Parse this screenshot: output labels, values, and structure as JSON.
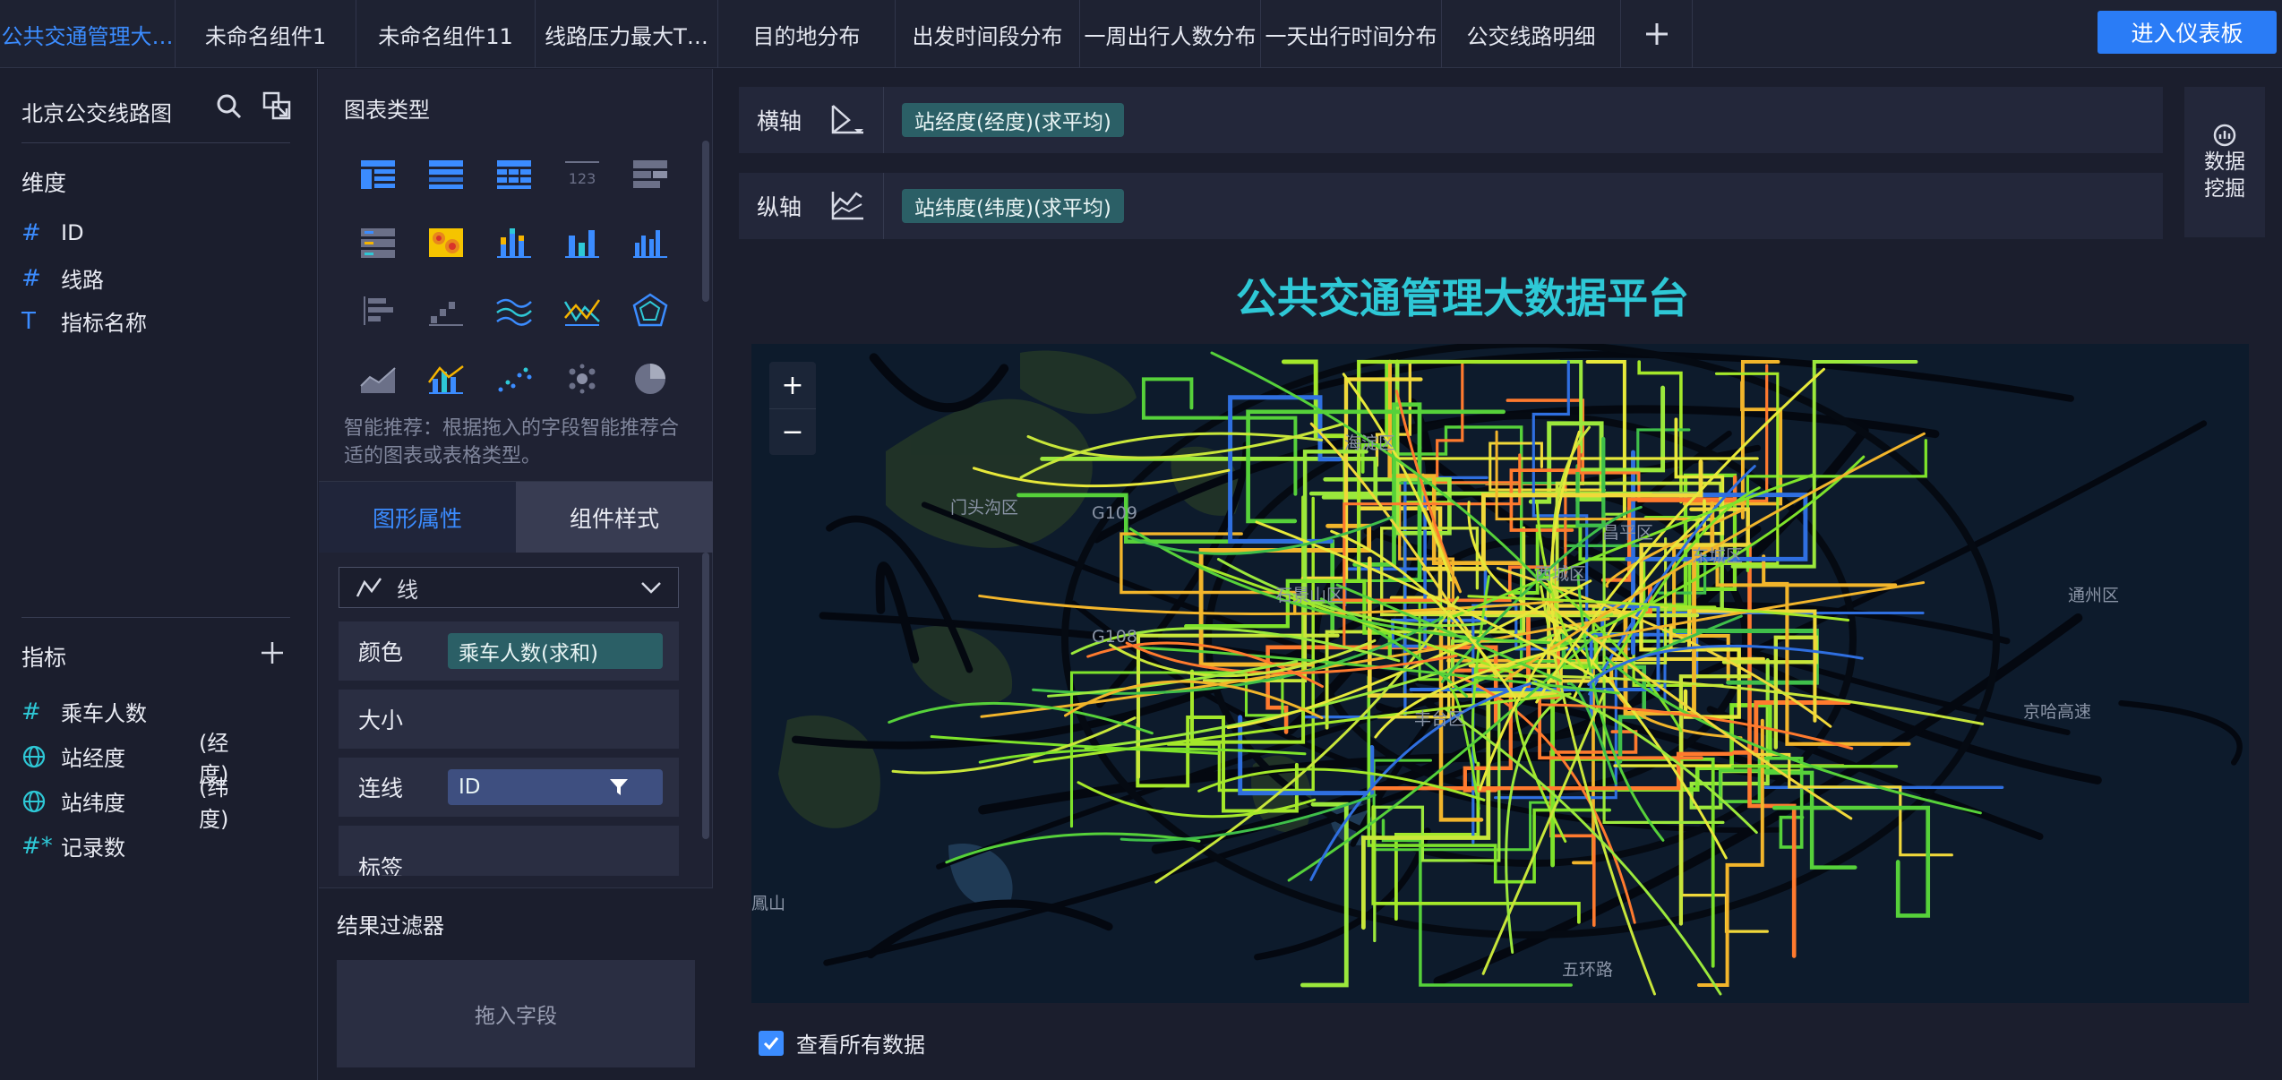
{
  "tabs": [
    {
      "label": "公共交通管理大…",
      "active": true
    },
    {
      "label": "未命名组件1"
    },
    {
      "label": "未命名组件11"
    },
    {
      "label": "线路压力最大T…"
    },
    {
      "label": "目的地分布"
    },
    {
      "label": "出发时间段分布"
    },
    {
      "label": "一周出行人数分布"
    },
    {
      "label": "一天出行时间分布"
    },
    {
      "label": "公交线路明细"
    }
  ],
  "header": {
    "add_tab_icon": "plus-icon",
    "enter_dashboard": "进入仪表板"
  },
  "dataset": {
    "name": "北京公交线路图",
    "dimensions_title": "维度",
    "dimensions": [
      {
        "type": "#",
        "label": "ID"
      },
      {
        "type": "#",
        "label": "线路"
      },
      {
        "type": "T",
        "label": "指标名称"
      }
    ],
    "metrics_title": "指标",
    "metrics": [
      {
        "type": "#",
        "label": "乘车人数",
        "suffix": ""
      },
      {
        "type": "globe",
        "label": "站经度",
        "suffix": "(经度)"
      },
      {
        "type": "globe",
        "label": "站纬度",
        "suffix": "(纬度)"
      },
      {
        "type": "#*",
        "label": "记录数",
        "suffix": ""
      }
    ]
  },
  "config": {
    "chart_types_title": "图表类型",
    "smart_tip": "智能推荐：根据拖入的字段智能推荐合适的图表或表格类型。",
    "tab_shape": "图形属性",
    "tab_style": "组件样式",
    "shape_select": "线",
    "color_label": "颜色",
    "color_field": "乘车人数(求和)",
    "size_label": "大小",
    "line_label": "连线",
    "line_field": "ID",
    "tag_label": "标签",
    "filter_title": "结果过滤器",
    "filter_placeholder": "拖入字段"
  },
  "axes": {
    "x_label": "横轴",
    "x_field": "站经度(经度)(求平均)",
    "y_label": "纵轴",
    "y_field": "站纬度(纬度)(求平均)"
  },
  "mining": {
    "line1": "数据",
    "line2": "挖掘"
  },
  "canvas": {
    "title": "公共交通管理大数据平台",
    "zoom_in": "+",
    "zoom_out": "−",
    "view_all": "查看所有数据",
    "view_all_checked": true
  },
  "map_labels": {
    "mentougou": "门头沟区",
    "haidian": "海淀区",
    "changping": "昌平区",
    "xicheng": "西城区",
    "dongcheng": "东城区",
    "chaoyang": "朝阳区",
    "fengtai": "丰台区",
    "tongzhou": "通州区",
    "shijingshan": "石景山区",
    "wuhuan": "五环路",
    "jinghu": "京哈高速",
    "g108": "G108",
    "g109": "G109",
    "mountain": "鳳山"
  },
  "colors": {
    "accent": "#3b8cff",
    "teal": "#2ec8d6",
    "pill": "#2b5f66"
  }
}
